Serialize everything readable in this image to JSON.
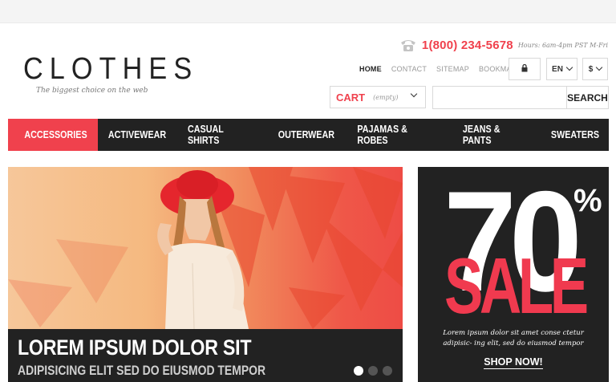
{
  "brand": {
    "name": "CLOTHES",
    "tagline": "The biggest choice on the web"
  },
  "contact": {
    "phone_icon": "telephone-icon",
    "phone": "1(800) 234-5678",
    "hours": "Hours: 6am-4pm PST M-Fri"
  },
  "top_links": [
    {
      "label": "HOME",
      "active": true
    },
    {
      "label": "CONTACT",
      "active": false
    },
    {
      "label": "SITEMAP",
      "active": false
    },
    {
      "label": "BOOKMARK",
      "active": false
    }
  ],
  "controls": {
    "lock_icon": "lock-icon",
    "language": "EN",
    "currency": "$"
  },
  "cart": {
    "label": "CART",
    "status": "(empty)"
  },
  "search": {
    "placeholder": "",
    "button_label": "SEARCH"
  },
  "main_nav": [
    {
      "label": "ACCESSORIES",
      "active": true
    },
    {
      "label": "ACTIVEWEAR",
      "active": false
    },
    {
      "label": "CASUAL SHIRTS",
      "active": false
    },
    {
      "label": "OUTERWEAR",
      "active": false
    },
    {
      "label": "PAJAMAS & ROBES",
      "active": false
    },
    {
      "label": "JEANS & PANTS",
      "active": false
    },
    {
      "label": "SWEATERS",
      "active": false
    }
  ],
  "slider": {
    "title": "LOREM IPSUM DOLOR SIT",
    "subtitle": "ADIPISICING ELIT SED DO EIUSMOD TEMPOR",
    "slide_count": 3,
    "active_slide": 1
  },
  "promo": {
    "number": "70",
    "percent": "%",
    "sale": "SALE",
    "text": "Lorem ipsum dolor sit amet conse ctetur adipisic- ing elit, sed do eiusmod tempor",
    "cta": "SHOP NOW!"
  },
  "colors": {
    "accent": "#f0414d",
    "dark": "#222222"
  }
}
